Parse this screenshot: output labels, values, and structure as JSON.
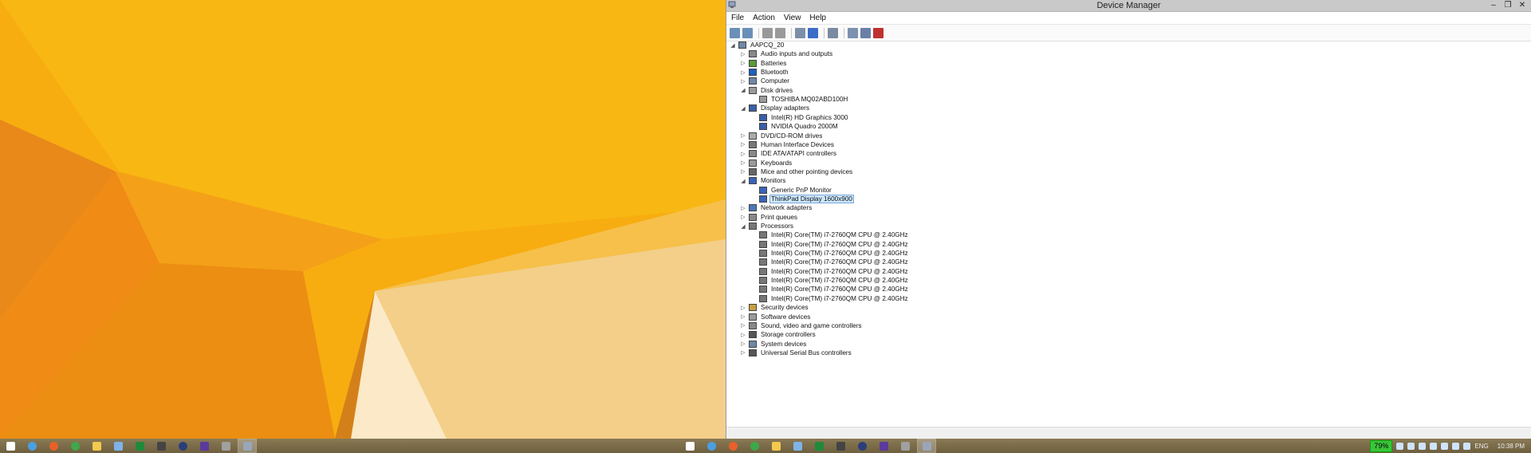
{
  "window": {
    "title": "Device Manager",
    "controls": {
      "minimize": "–",
      "maximize": "❐",
      "close": "✕"
    }
  },
  "menu": [
    "File",
    "Action",
    "View",
    "Help"
  ],
  "toolbar_icons": [
    "back-icon",
    "forward-icon",
    "sep",
    "show-hide-tree-icon",
    "properties-icon",
    "sep",
    "help-icon",
    "view-icon",
    "sep",
    "scan-hardware-icon",
    "sep",
    "update-driver-icon",
    "uninstall-icon",
    "disable-icon"
  ],
  "tree": [
    {
      "level": 0,
      "exp": "open",
      "icon": "computer-icon",
      "label": "AAPCQ_20"
    },
    {
      "level": 1,
      "exp": "closed",
      "icon": "audio-icon",
      "label": "Audio inputs and outputs"
    },
    {
      "level": 1,
      "exp": "closed",
      "icon": "battery-icon",
      "label": "Batteries"
    },
    {
      "level": 1,
      "exp": "closed",
      "icon": "bluetooth-icon",
      "label": "Bluetooth"
    },
    {
      "level": 1,
      "exp": "closed",
      "icon": "computer-icon",
      "label": "Computer"
    },
    {
      "level": 1,
      "exp": "open",
      "icon": "disk-icon",
      "label": "Disk drives"
    },
    {
      "level": 2,
      "exp": "none",
      "icon": "disk-icon",
      "label": "TOSHIBA MQ02ABD100H"
    },
    {
      "level": 1,
      "exp": "open",
      "icon": "display-icon",
      "label": "Display adapters"
    },
    {
      "level": 2,
      "exp": "none",
      "icon": "display-icon",
      "label": "Intel(R) HD Graphics 3000"
    },
    {
      "level": 2,
      "exp": "none",
      "icon": "display-icon",
      "label": "NVIDIA Quadro 2000M"
    },
    {
      "level": 1,
      "exp": "closed",
      "icon": "dvd-icon",
      "label": "DVD/CD-ROM drives"
    },
    {
      "level": 1,
      "exp": "closed",
      "icon": "hid-icon",
      "label": "Human Interface Devices"
    },
    {
      "level": 1,
      "exp": "closed",
      "icon": "ide-icon",
      "label": "IDE ATA/ATAPI controllers"
    },
    {
      "level": 1,
      "exp": "closed",
      "icon": "keyboard-icon",
      "label": "Keyboards"
    },
    {
      "level": 1,
      "exp": "closed",
      "icon": "mouse-icon",
      "label": "Mice and other pointing devices"
    },
    {
      "level": 1,
      "exp": "open",
      "icon": "monitor-icon",
      "label": "Monitors"
    },
    {
      "level": 2,
      "exp": "none",
      "icon": "monitor-icon",
      "label": "Generic PnP Monitor"
    },
    {
      "level": 2,
      "exp": "none",
      "icon": "monitor-icon",
      "label": "ThinkPad Display 1600x900",
      "selected": true
    },
    {
      "level": 1,
      "exp": "closed",
      "icon": "network-icon",
      "label": "Network adapters"
    },
    {
      "level": 1,
      "exp": "closed",
      "icon": "printer-icon",
      "label": "Print queues"
    },
    {
      "level": 1,
      "exp": "open",
      "icon": "processor-icon",
      "label": "Processors"
    },
    {
      "level": 2,
      "exp": "none",
      "icon": "processor-icon",
      "label": "Intel(R) Core(TM) i7-2760QM CPU @ 2.40GHz"
    },
    {
      "level": 2,
      "exp": "none",
      "icon": "processor-icon",
      "label": "Intel(R) Core(TM) i7-2760QM CPU @ 2.40GHz"
    },
    {
      "level": 2,
      "exp": "none",
      "icon": "processor-icon",
      "label": "Intel(R) Core(TM) i7-2760QM CPU @ 2.40GHz"
    },
    {
      "level": 2,
      "exp": "none",
      "icon": "processor-icon",
      "label": "Intel(R) Core(TM) i7-2760QM CPU @ 2.40GHz"
    },
    {
      "level": 2,
      "exp": "none",
      "icon": "processor-icon",
      "label": "Intel(R) Core(TM) i7-2760QM CPU @ 2.40GHz"
    },
    {
      "level": 2,
      "exp": "none",
      "icon": "processor-icon",
      "label": "Intel(R) Core(TM) i7-2760QM CPU @ 2.40GHz"
    },
    {
      "level": 2,
      "exp": "none",
      "icon": "processor-icon",
      "label": "Intel(R) Core(TM) i7-2760QM CPU @ 2.40GHz"
    },
    {
      "level": 2,
      "exp": "none",
      "icon": "processor-icon",
      "label": "Intel(R) Core(TM) i7-2760QM CPU @ 2.40GHz"
    },
    {
      "level": 1,
      "exp": "closed",
      "icon": "security-icon",
      "label": "Security devices"
    },
    {
      "level": 1,
      "exp": "closed",
      "icon": "software-icon",
      "label": "Software devices"
    },
    {
      "level": 1,
      "exp": "closed",
      "icon": "sound-icon",
      "label": "Sound, video and game controllers"
    },
    {
      "level": 1,
      "exp": "closed",
      "icon": "storage-icon",
      "label": "Storage controllers"
    },
    {
      "level": 1,
      "exp": "closed",
      "icon": "system-icon",
      "label": "System devices"
    },
    {
      "level": 1,
      "exp": "closed",
      "icon": "usb-icon",
      "label": "Universal Serial Bus controllers"
    }
  ],
  "taskbar_left": [
    {
      "icon": "windows-start-icon",
      "color": "#ffffff"
    },
    {
      "icon": "ie-icon",
      "color": "#4a9fe0"
    },
    {
      "icon": "firefox-icon",
      "color": "#e8602a"
    },
    {
      "icon": "chrome-icon",
      "color": "#3ea84a"
    },
    {
      "icon": "file-explorer-icon",
      "color": "#f2c94c"
    },
    {
      "icon": "network-icon",
      "color": "#7fb3e8"
    },
    {
      "icon": "excel-icon",
      "color": "#1f8a3a"
    },
    {
      "icon": "tool-icon",
      "color": "#444444"
    },
    {
      "icon": "eclipse-icon",
      "color": "#2a3f7a"
    },
    {
      "icon": "z-app-icon",
      "color": "#5b3a9e"
    },
    {
      "icon": "remote-icon",
      "color": "#a0a0a0"
    },
    {
      "icon": "device-manager-icon",
      "color": "#9aa6b8",
      "active": true
    }
  ],
  "taskbar_right_apps": [
    {
      "icon": "windows-start-icon",
      "color": "#ffffff"
    },
    {
      "icon": "ie-icon",
      "color": "#4a9fe0"
    },
    {
      "icon": "firefox-icon",
      "color": "#e8602a"
    },
    {
      "icon": "chrome-icon",
      "color": "#3ea84a"
    },
    {
      "icon": "file-explorer-icon",
      "color": "#f2c94c"
    },
    {
      "icon": "network-icon",
      "color": "#7fb3e8"
    },
    {
      "icon": "excel-icon",
      "color": "#1f8a3a"
    },
    {
      "icon": "tool-icon",
      "color": "#444444"
    },
    {
      "icon": "eclipse-icon",
      "color": "#2a3f7a"
    },
    {
      "icon": "z-app-icon",
      "color": "#5b3a9e"
    },
    {
      "icon": "remote-icon",
      "color": "#a0a0a0"
    },
    {
      "icon": "device-manager-icon",
      "color": "#9aa6b8",
      "active": true
    }
  ],
  "tray": {
    "battery": "79%",
    "language": "ENG",
    "time": "10:38 PM"
  }
}
